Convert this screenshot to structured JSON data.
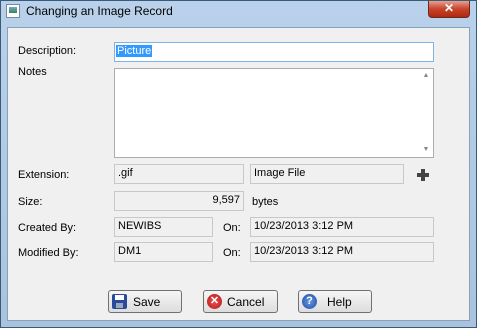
{
  "window": {
    "title": "Changing an Image Record",
    "close_glyph": "✕"
  },
  "form": {
    "description_label": "Description:",
    "description_value": "Picture",
    "notes_label": "Notes",
    "notes_value": "",
    "extension_label": "Extension:",
    "extension_value": ".gif",
    "file_type_value": "Image File",
    "size_label": "Size:",
    "size_value": "9,597",
    "size_unit": "bytes",
    "created_by_label": "Created By:",
    "created_by_value": "NEWIBS",
    "created_on_label": "On:",
    "created_on_value": "10/23/2013 3:12 PM",
    "modified_by_label": "Modified By:",
    "modified_by_value": "DM1",
    "modified_on_label": "On:",
    "modified_on_value": "10/23/2013 3:12 PM"
  },
  "buttons": {
    "save": "Save",
    "cancel": "Cancel",
    "help": "Help"
  },
  "icons": {
    "window": "image-record-icon",
    "add": "plus-icon",
    "save": "floppy-disk-icon",
    "cancel": "cancel-x-icon",
    "help": "help-question-icon"
  },
  "colors": {
    "selection": "#3399ff",
    "focus_border": "#7eb4ea",
    "close_button": "#c8432b"
  }
}
